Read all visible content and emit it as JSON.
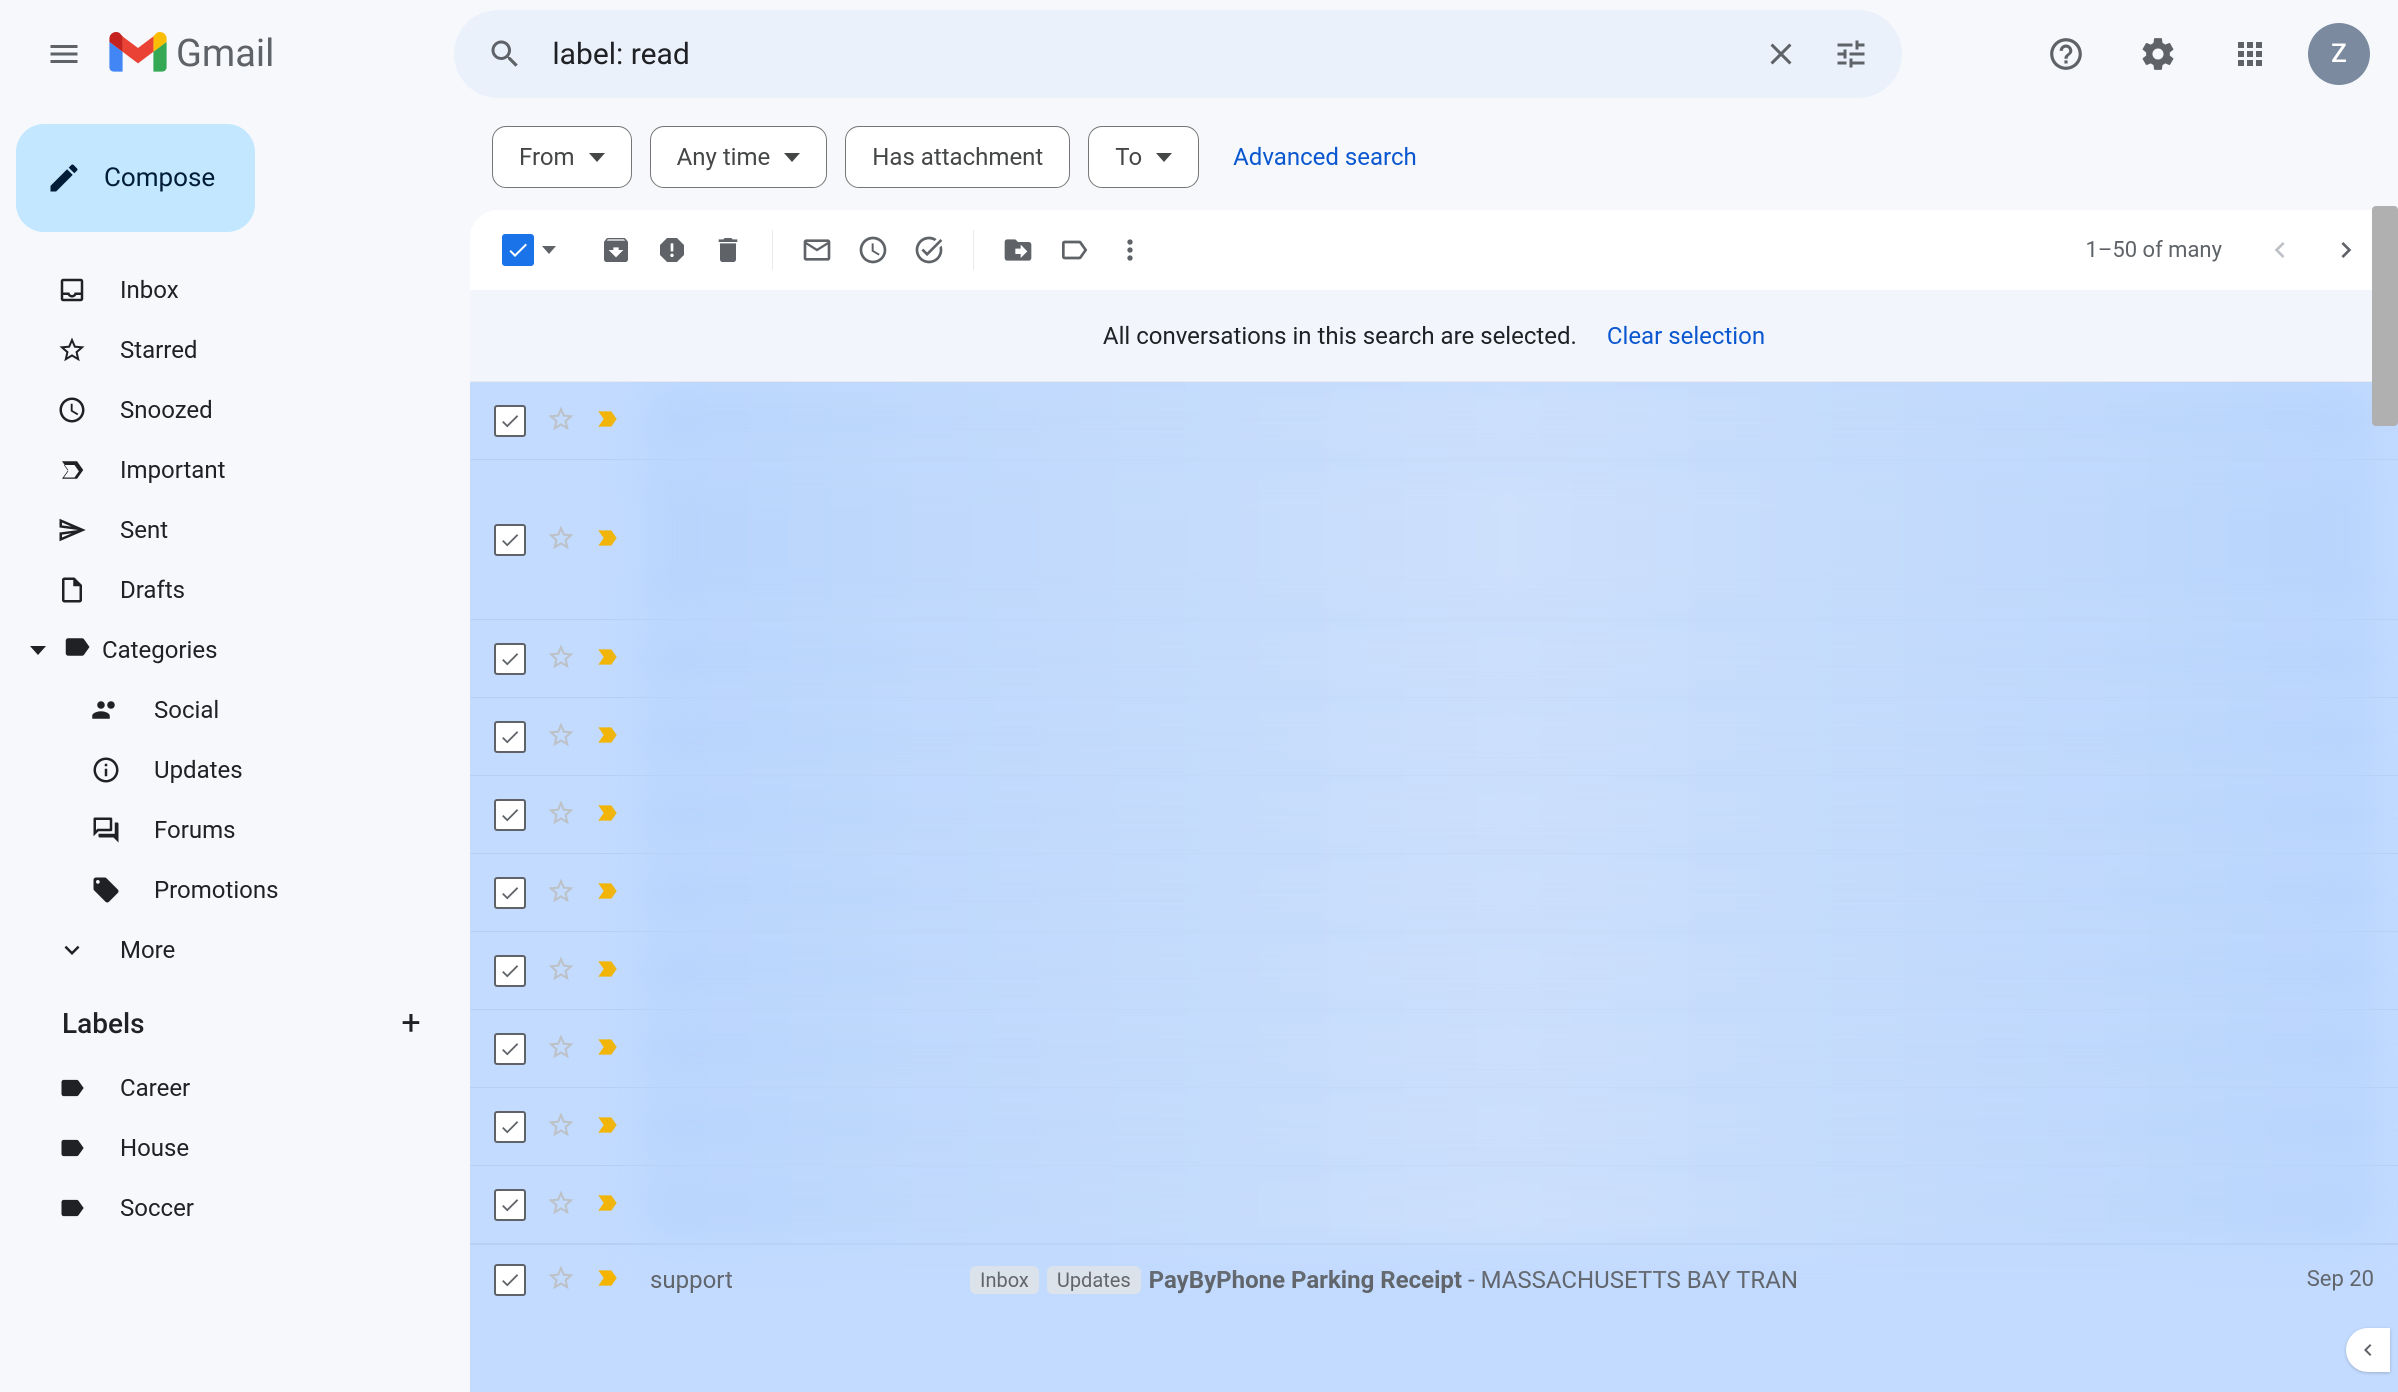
{
  "header": {
    "logo_text": "Gmail",
    "search_value": "label: read",
    "avatar_initial": "Z"
  },
  "nav": {
    "compose_label": "Compose",
    "items": [
      {
        "icon": "inbox",
        "label": "Inbox"
      },
      {
        "icon": "star",
        "label": "Starred"
      },
      {
        "icon": "clock",
        "label": "Snoozed"
      },
      {
        "icon": "important",
        "label": "Important"
      },
      {
        "icon": "send",
        "label": "Sent"
      },
      {
        "icon": "draft",
        "label": "Drafts"
      }
    ],
    "categories_label": "Categories",
    "categories": [
      {
        "icon": "social",
        "label": "Social"
      },
      {
        "icon": "updates",
        "label": "Updates"
      },
      {
        "icon": "forums",
        "label": "Forums"
      },
      {
        "icon": "promotions",
        "label": "Promotions"
      }
    ],
    "more_label": "More",
    "labels_header": "Labels",
    "labels": [
      {
        "label": "Career"
      },
      {
        "label": "House"
      },
      {
        "label": "Soccer"
      }
    ]
  },
  "filters": {
    "from": "From",
    "any_time": "Any time",
    "has_attachment": "Has attachment",
    "to": "To",
    "advanced": "Advanced search"
  },
  "toolbar": {
    "page_info": "1–50 of many"
  },
  "banner": {
    "text": "All conversations in this search are selected.",
    "clear": "Clear selection"
  },
  "visible_row": {
    "sender": "support",
    "tag1": "Inbox",
    "tag2": "Updates",
    "subject": "PayByPhone Parking Receipt",
    "preview": " - MASSACHUSETTS BAY TRAN",
    "date": "Sep 20"
  }
}
